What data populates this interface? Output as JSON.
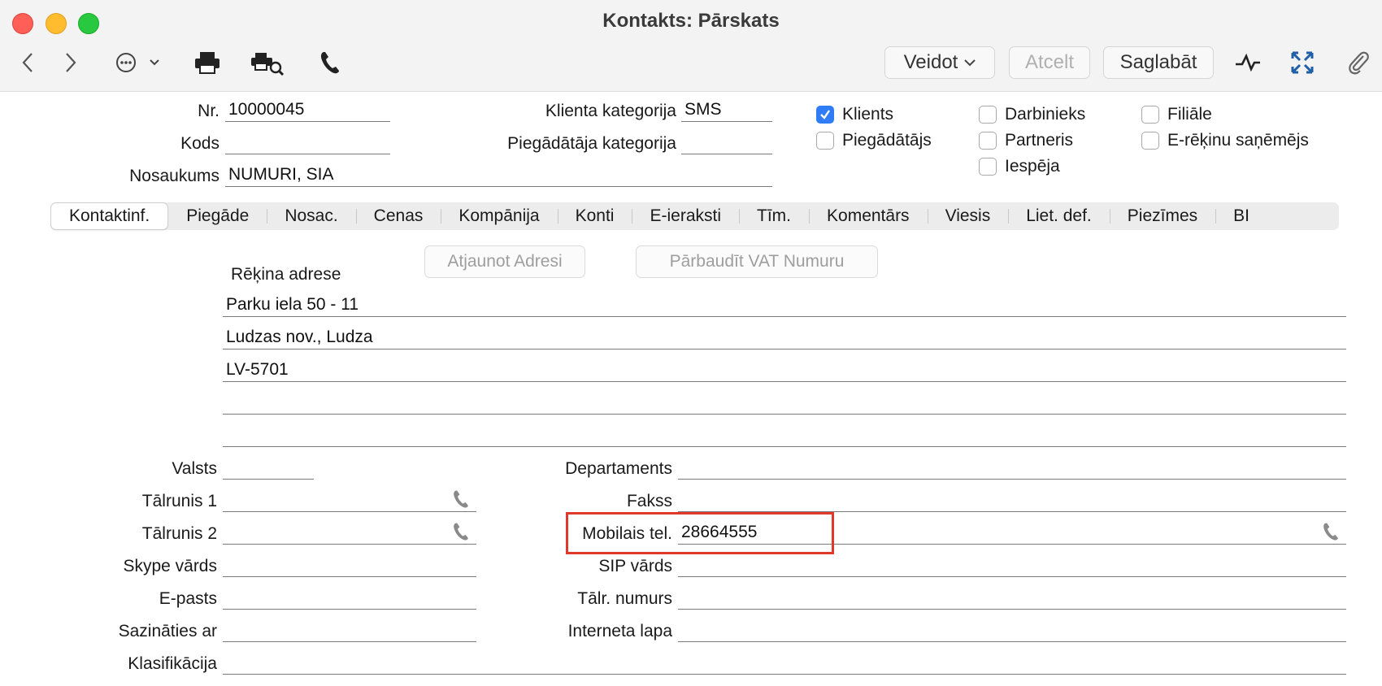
{
  "window": {
    "title": "Kontakts: Pārskats"
  },
  "toolbar": {
    "create_label": "Veidot",
    "cancel_label": "Atcelt",
    "save_label": "Saglabāt"
  },
  "header": {
    "nr_label": "Nr.",
    "nr_value": "10000045",
    "code_label": "Kods",
    "code_value": "",
    "name_label": "Nosaukums",
    "name_value": "NUMURI, SIA",
    "client_cat_label": "Klienta kategorija",
    "client_cat_value": "SMS",
    "supplier_cat_label": "Piegādātāja kategorija",
    "supplier_cat_value": ""
  },
  "checkboxes": [
    {
      "label": "Klients",
      "checked": true
    },
    {
      "label": "Piegādātājs",
      "checked": false
    },
    {
      "label": "Darbinieks",
      "checked": false
    },
    {
      "label": "Partneris",
      "checked": false
    },
    {
      "label": "Iespēja",
      "checked": false
    },
    {
      "label": "Filiāle",
      "checked": false
    },
    {
      "label": "E-rēķinu saņēmējs",
      "checked": false
    }
  ],
  "tabs": [
    {
      "label": "Kontaktinf."
    },
    {
      "label": "Piegāde"
    },
    {
      "label": "Nosac."
    },
    {
      "label": "Cenas"
    },
    {
      "label": "Kompānija"
    },
    {
      "label": "Konti"
    },
    {
      "label": "E-ieraksti"
    },
    {
      "label": "Tīm."
    },
    {
      "label": "Komentārs"
    },
    {
      "label": "Viesis"
    },
    {
      "label": "Liet. def."
    },
    {
      "label": "Piezīmes"
    },
    {
      "label": "BI"
    }
  ],
  "address": {
    "update_button": "Atjaunot Adresi",
    "vat_button": "Pārbaudīt VAT Numuru",
    "title": "Rēķina adrese",
    "lines": [
      "Parku iela 50 - 11",
      "Ludzas nov., Ludza",
      "LV-5701",
      "",
      ""
    ]
  },
  "contact": {
    "country_label": "Valsts",
    "country_value": "",
    "phone1_label": "Tālrunis 1",
    "phone1_value": "",
    "phone2_label": "Tālrunis 2",
    "phone2_value": "",
    "skype_label": "Skype vārds",
    "skype_value": "",
    "email_label": "E-pasts",
    "email_value": "",
    "contact_with_label": "Sazināties ar",
    "contact_with_value": "",
    "classification_label": "Klasifikācija",
    "classification_value": "",
    "department_label": "Departaments",
    "department_value": "",
    "fax_label": "Fakss",
    "fax_value": "",
    "mobile_label": "Mobilais tel.",
    "mobile_value": "28664555",
    "sip_label": "SIP vārds",
    "sip_value": "",
    "phone_number_label": "Tālr. numurs",
    "phone_number_value": "",
    "website_label": "Interneta lapa",
    "website_value": ""
  },
  "colors": {
    "accent": "#2f7cf6",
    "highlight": "#e0392b"
  }
}
